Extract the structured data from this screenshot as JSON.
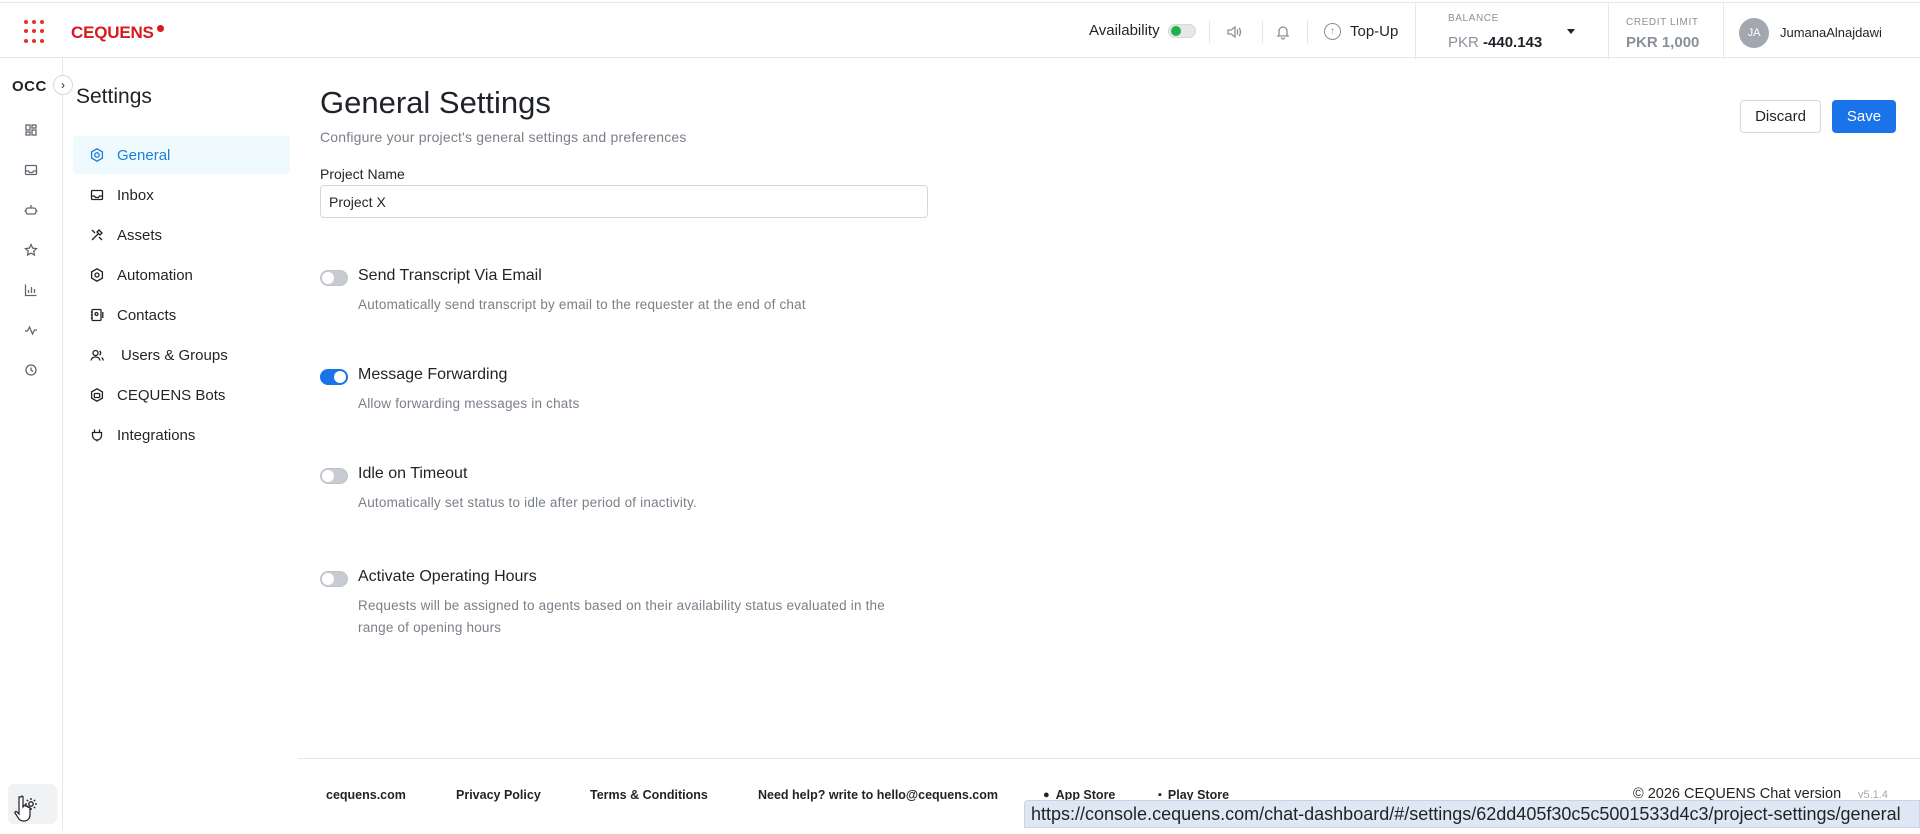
{
  "header": {
    "logo_text": "CEQUENS",
    "availability_label": "Availability",
    "availability_on": true,
    "topup_label": "Top-Up",
    "balance_label": "BALANCE",
    "balance_currency": "PKR",
    "balance_value": "-440.143",
    "credit_limit_label": "CREDIT LIMIT",
    "credit_limit_value": "PKR 1,000",
    "avatar_initials": "JA",
    "username": "JumanaAlnajdawi"
  },
  "rail": {
    "workspace": "OCC",
    "icons": [
      "dashboard-icon",
      "inbox-icon",
      "bot-icon",
      "star-icon",
      "chart-icon",
      "activity-icon",
      "history-icon"
    ],
    "bottom_icon": "settings-gear-icon"
  },
  "settings_nav": {
    "title": "Settings",
    "items": [
      {
        "label": "General",
        "icon": "gear-icon",
        "active": true
      },
      {
        "label": "Inbox",
        "icon": "inbox-icon",
        "active": false
      },
      {
        "label": "Assets",
        "icon": "tools-icon",
        "active": false
      },
      {
        "label": "Automation",
        "icon": "hexagon-icon",
        "active": false
      },
      {
        "label": "Contacts",
        "icon": "contacts-icon",
        "active": false
      },
      {
        "label": "Users & Groups",
        "icon": "users-icon",
        "active": false
      },
      {
        "label": "CEQUENS Bots",
        "icon": "bot-icon",
        "active": false
      },
      {
        "label": "Integrations",
        "icon": "plug-icon",
        "active": false
      }
    ]
  },
  "main": {
    "title": "General Settings",
    "subtitle": "Configure your project's general settings and preferences",
    "discard_label": "Discard",
    "save_label": "Save",
    "project_name_label": "Project Name",
    "project_name_value": "Project X",
    "settings": [
      {
        "title": "Send Transcript Via Email",
        "desc": "Automatically send transcript by email to the requester at the end of chat",
        "enabled": false
      },
      {
        "title": "Message Forwarding",
        "desc": "Allow forwarding messages in chats",
        "enabled": true
      },
      {
        "title": "Idle on Timeout",
        "desc": "Automatically set status to idle after period of inactivity.",
        "enabled": false
      },
      {
        "title": "Activate Operating Hours",
        "desc": "Requests will be assigned to agents based on their availability status evaluated in the range of opening hours",
        "enabled": false
      }
    ]
  },
  "footer": {
    "site": "cequens.com",
    "privacy": "Privacy Policy",
    "terms": "Terms & Conditions",
    "help": "Need help? write to hello@cequens.com",
    "app_store": "App Store",
    "play_store": "Play Store",
    "copyright": "© 2026 CEQUENS Chat version",
    "version": "v5.1.4"
  },
  "status_url": "https://console.cequens.com/chat-dashboard/#/settings/62dd405f30c5c5001533d4c3/project-settings/general"
}
